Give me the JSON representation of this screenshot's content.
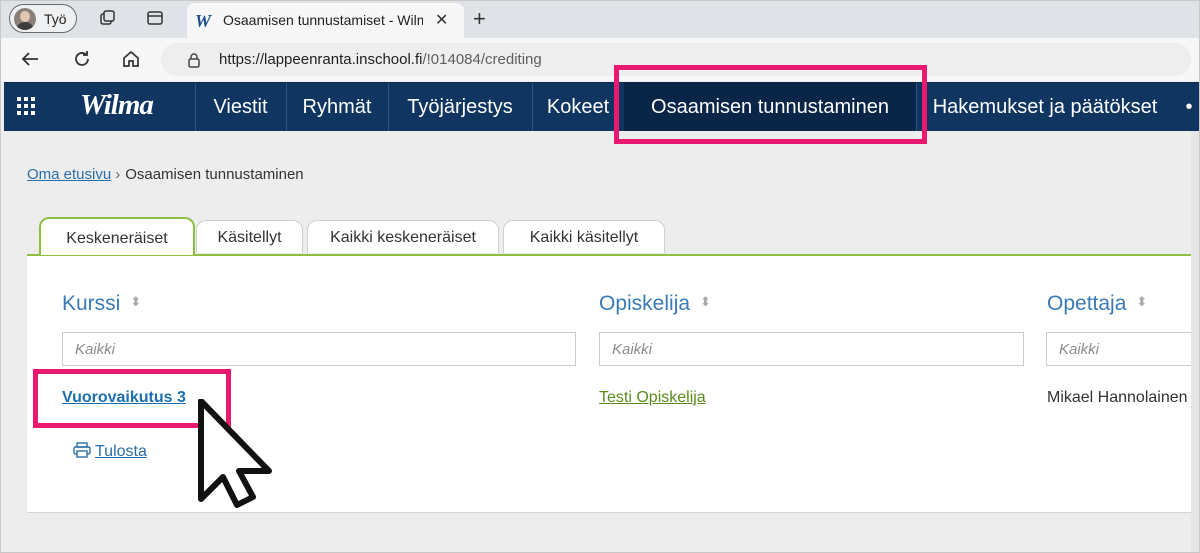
{
  "browser": {
    "profile_label": "Työ",
    "tab_favicon": "W",
    "tab_title": "Osaamisen tunnustamiset - Wilma",
    "url_host": "https://lappeenranta.inschool.fi",
    "url_path": "/!014084/crediting"
  },
  "navbar": {
    "logo": "Wilma",
    "items": [
      {
        "label": "Viestit"
      },
      {
        "label": "Ryhmät"
      },
      {
        "label": "Työjärjestys"
      },
      {
        "label": "Kokeet"
      },
      {
        "label": "Osaamisen tunnustaminen",
        "active": true
      },
      {
        "label": "Hakemukset ja päätökset"
      }
    ],
    "more": "•"
  },
  "breadcrumb": {
    "home": "Oma etusivu",
    "sep": "›",
    "current": "Osaamisen tunnustaminen"
  },
  "tabs": [
    {
      "label": "Keskeneräiset",
      "active": true
    },
    {
      "label": "Käsitellyt"
    },
    {
      "label": "Kaikki keskeneräiset"
    },
    {
      "label": "Kaikki käsitellyt"
    }
  ],
  "table": {
    "columns": [
      {
        "label": "Kurssi",
        "filter_placeholder": "Kaikki"
      },
      {
        "label": "Opiskelija",
        "filter_placeholder": "Kaikki"
      },
      {
        "label": "Opettaja",
        "filter_placeholder": "Kaikki"
      }
    ],
    "rows": [
      {
        "course": "Vuorovaikutus 3",
        "student": "Testi Opiskelija",
        "teacher": "Mikael Hannolainen"
      }
    ]
  },
  "print_label": "Tulosta",
  "colors": {
    "navbar": "#0f3560",
    "highlight": "#e8196f",
    "tab_accent": "#8fbf3f",
    "link": "#1d6fae",
    "student_link": "#5a8c1d"
  },
  "icons": [
    "grid-icon",
    "sort-icon",
    "printer-icon",
    "back-icon",
    "reload-icon",
    "home-icon",
    "lock-icon",
    "close-icon",
    "plus-icon",
    "collections-icon",
    "tab-actions-icon",
    "cursor-arrow-icon"
  ]
}
